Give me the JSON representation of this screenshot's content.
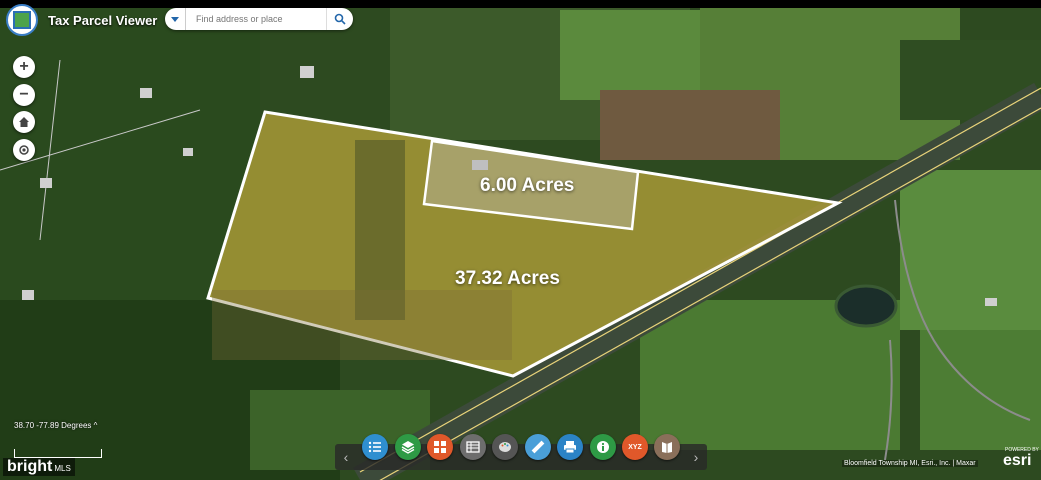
{
  "app": {
    "title": "Tax Parcel Viewer"
  },
  "search": {
    "placeholder": "Find address or place"
  },
  "map_controls": {
    "zoom_in": "+",
    "zoom_out": "−"
  },
  "status": {
    "coordinates": "38.70 -77.89 Degrees"
  },
  "parcels": [
    {
      "label": "6.00 Acres"
    },
    {
      "label": "37.32 Acres"
    }
  ],
  "toolbar": {
    "prev": "‹",
    "next": "›",
    "buttons": [
      {
        "name": "legend",
        "color": "#2f8fd0"
      },
      {
        "name": "layers",
        "color": "#2e9a45"
      },
      {
        "name": "basemap",
        "color": "#e0582a"
      },
      {
        "name": "attribute-table",
        "color": "#6d6d6d"
      },
      {
        "name": "draw",
        "color": "#555555"
      },
      {
        "name": "measure",
        "color": "#4a9fd8"
      },
      {
        "name": "print",
        "color": "#2b83c6"
      },
      {
        "name": "identify",
        "color": "#2e9a45"
      },
      {
        "name": "xyz-coordinates",
        "color": "#e0582a",
        "text": "XYZ"
      },
      {
        "name": "about",
        "color": "#8a6f5a"
      }
    ]
  },
  "attribution": "Bloomfield Township MI, Esri., Inc. | Maxar",
  "branding": {
    "powered_by": "POWERED BY",
    "esri": "esri",
    "bright": "bright",
    "mls": "MLS"
  },
  "colors": {
    "parcel_outline": "#ffffff",
    "parcel_fill": "#b8a43a",
    "road": "#e8d37a",
    "forest": "#24401b",
    "field": "#5a8a3a"
  }
}
